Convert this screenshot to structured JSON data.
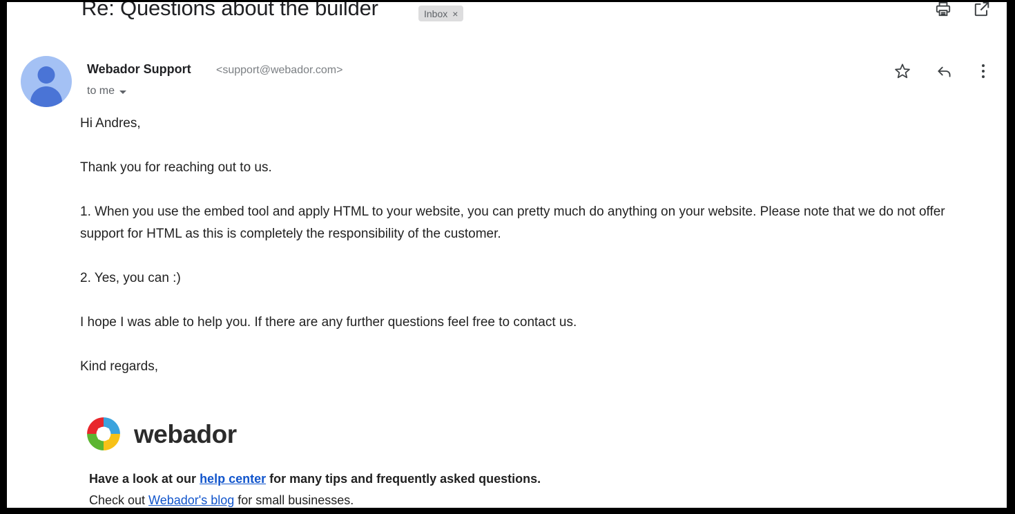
{
  "header": {
    "subject": "Re: Questions about the builder",
    "label_badge": "Inbox",
    "label_badge_close": "×",
    "print_icon": "print-icon",
    "popout_icon": "open-in-new-window-icon"
  },
  "sender": {
    "name": "Webador Support",
    "email": "<support@webador.com>",
    "recipient": "to me",
    "star_icon": "star-icon",
    "reply_icon": "reply-icon",
    "more_icon": "more-options-icon"
  },
  "body": {
    "greeting": "Hi Andres,",
    "paragraph_thanks": "Thank you for reaching out to us.",
    "paragraph_1": "1. When you use the embed tool and apply HTML to your website, you can pretty much do anything on your website. Please note that we do not offer support for HTML as this is completely the responsibility of the customer.",
    "paragraph_2": "2. Yes, you can :)",
    "paragraph_closing": "I hope I was able to help you. If there are any further questions feel free to contact us.",
    "signoff": "Kind regards,"
  },
  "logo": {
    "wordmark": "webador",
    "mark_icon": "webador-pinwheel-logo-icon",
    "colors": {
      "red": "#e8272c",
      "blue": "#3ba3dd",
      "yellow": "#f7c117",
      "green": "#5cb531"
    }
  },
  "footer": {
    "line1_before": "Have a look at our ",
    "line1_link": "help center",
    "line1_after": " for many tips and frequently asked questions.",
    "line2_before": "Check out ",
    "line2_link": "Webador's blog",
    "line2_after": " for small businesses.",
    "link_color": "#1155cc"
  }
}
